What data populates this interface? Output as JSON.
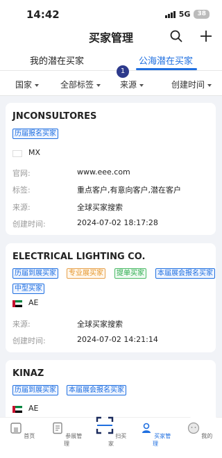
{
  "status_bar": {
    "time": "14:42",
    "network": "5G",
    "battery": "38"
  },
  "nav": {
    "title": "买家管理",
    "search_icon": "search-icon",
    "add_icon": "plus-icon"
  },
  "tabs": [
    {
      "label": "我的潜在买家"
    },
    {
      "label": "公海潜在买家",
      "active": true
    }
  ],
  "tab_badge": "1",
  "filters": [
    {
      "label": "国家"
    },
    {
      "label": "全部标签"
    },
    {
      "label": "来源"
    },
    {
      "label": "创建时间"
    }
  ],
  "labels": {
    "website": "官网:",
    "tags": "标签:",
    "source": "来源:",
    "created": "创建时间:"
  },
  "cards": [
    {
      "company": "JNCONSULTORES",
      "tags": [
        "历届报名买家"
      ],
      "country": "MX",
      "website": "www.eee.com",
      "label_tags": "重点客户,有意向客户,潜在客户",
      "source": "全球买家搜索",
      "created": "2024-07-02 18:17:28"
    },
    {
      "company": "ELECTRICAL LIGHTING CO.",
      "tags": [
        "历届到展买家",
        "专业展买家",
        "提单买家",
        "本届展会报名买家",
        "中型买家"
      ],
      "country": "AE",
      "source": "全球买家搜索",
      "created": "2024-07-02 14:21:14"
    },
    {
      "company": "KINAZ",
      "tags": [
        "历届到展买家",
        "本届展会报名买家"
      ],
      "country": "AE"
    }
  ],
  "tabbar": [
    {
      "label": "首页",
      "icon": "home-icon"
    },
    {
      "label": "参展管理",
      "icon": "document-icon"
    },
    {
      "label": "扫买家",
      "icon": "scan-icon"
    },
    {
      "label": "买家管理",
      "icon": "buyer-icon",
      "active": true
    },
    {
      "label": "我的",
      "icon": "profile-icon"
    }
  ],
  "colors": {
    "accent": "#1f6fe0",
    "badge": "#2d3a8c",
    "orange": "#e6962b",
    "green": "#2eac4e"
  }
}
